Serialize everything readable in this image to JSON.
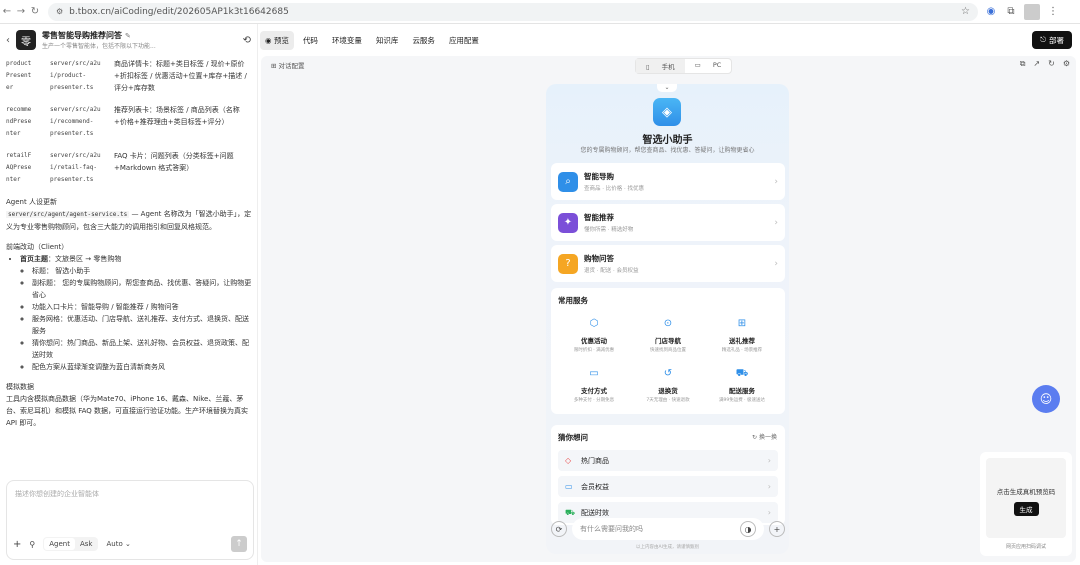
{
  "browser": {
    "url": "b.tbox.cn/aiCoding/edit/202605AP1k3t16642685"
  },
  "left": {
    "title": "零售智能导购推荐问答",
    "subtitle": "生产一个零售智能体，包括不限以下功能...",
    "avatar": "零",
    "table_rows": [
      {
        "c1": [
          "product",
          "Present",
          "er"
        ],
        "c2": [
          "server/src/a2u",
          "i/product-",
          "presenter.ts"
        ],
        "c3": "商品详情卡：标题+类目标签 / 现价+原价+折扣标签 / 优惠活动+位置+库存+描述 / 评分+库存数"
      },
      {
        "c1": [
          "recomme",
          "ndPrese",
          "nter"
        ],
        "c2": [
          "server/src/a2u",
          "i/recommend-",
          "presenter.ts"
        ],
        "c3": "推荐列表卡：场景标签 / 商品列表（名称+价格+推荐理由+类目标签+评分）"
      },
      {
        "c1": [
          "retailF",
          "AQPrese",
          "nter"
        ],
        "c2": [
          "server/src/a2u",
          "i/retail-faq-",
          "presenter.ts"
        ],
        "c3": "FAQ 卡片：问题列表（分类标签+问题+Markdown 格式答案）"
      }
    ],
    "agent_heading": "Agent 人设更新",
    "agent_code": "server/src/agent/agent-service.ts",
    "agent_text": "— Agent 名称改为「智选小助手」，定义为专业零售购物顾问，包含三大能力的调用指引和回复风格规范。",
    "frontend_heading": "前端改动（Client）",
    "home_label": "首页主题",
    "home_text": "：文旅景区 → 零售购物",
    "bullets": [
      "标题： 智选小助手",
      "副标题： 您的专属购物顾问，帮您查商品、找优惠、答疑问，让购物更省心",
      "功能入口卡片：智能导购 / 智能推荐 / 购物问答",
      "服务网格：优惠活动、门店导航、送礼推荐、支付方式、退换货、配送服务",
      "猜你想问：热门商品、新品上架、送礼好物、会员权益、退货政策、配送时效",
      "配色方案从蓝绿渐变调整为蓝白清新商务风"
    ],
    "mock_heading": "模拟数据",
    "mock_text": "工具内含模拟商品数据（华为Mate70、iPhone 16、戴森、Nike、兰蔻、茅台、索尼耳机）和模拟 FAQ 数据，可直接运行验证功能。生产环境替换为真实 API 即可。",
    "composer_placeholder": "描述你想创建的企业智能体",
    "mode_agent": "Agent",
    "mode_ask": "Ask",
    "auto_label": "Auto"
  },
  "toolbar": {
    "tabs": [
      "预览",
      "代码",
      "环境变量",
      "知识库",
      "云服务",
      "应用配置"
    ],
    "deploy": "部署"
  },
  "preview": {
    "dialog_config": "对话配置",
    "device_mobile": "手机",
    "device_pc": "PC",
    "app_title": "智选小助手",
    "app_subtitle": "您的专属购物顾问，帮您查商品、找优惠、答疑问，让购物更省心",
    "cards": [
      {
        "name": "智能导购",
        "desc": "查商品 · 比价格 · 找优惠"
      },
      {
        "name": "智能推荐",
        "desc": "懂你所需 · 精选好物"
      },
      {
        "name": "购物问答",
        "desc": "退货 · 配送 · 会员权益"
      }
    ],
    "services_title": "常用服务",
    "services": [
      {
        "name": "优惠活动",
        "desc": "限时折扣 · 满减优惠"
      },
      {
        "name": "门店导航",
        "desc": "快速找到商品位置"
      },
      {
        "name": "送礼推荐",
        "desc": "精选礼品 · 场景推荐"
      },
      {
        "name": "支付方式",
        "desc": "多种支付 · 分期免息"
      },
      {
        "name": "退换货",
        "desc": "7天无理由 · 快速退款"
      },
      {
        "name": "配送服务",
        "desc": "满99免运费 · 极速送达"
      }
    ],
    "guess_title": "猜你想问",
    "refresh": "换一换",
    "guess_items": [
      "热门商品",
      "会员权益",
      "配送时效"
    ],
    "input_placeholder": "有什么需要问我的吗",
    "disclaimer": "以上内容由AI生成，请谨慎甄别",
    "qr_text": "点击生成真机预览码",
    "qr_button": "生成",
    "qr_caption": "网页应用扫码调试"
  }
}
